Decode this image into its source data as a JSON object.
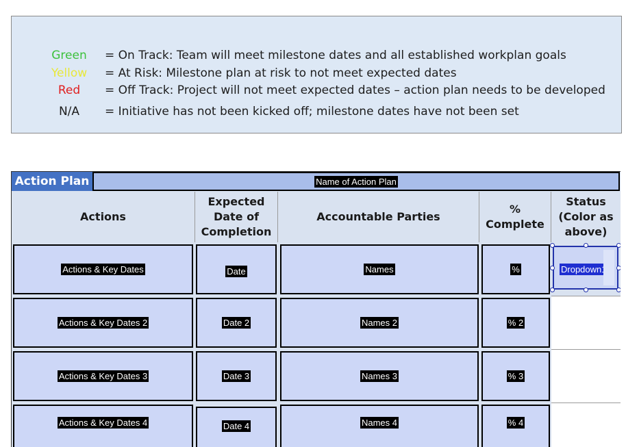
{
  "legend": {
    "items": [
      {
        "key": "Green",
        "color": "#3dc13c",
        "desc": "= On Track: Team will meet milestone dates and all established workplan goals"
      },
      {
        "key": "Yellow",
        "color": "#e8e83a",
        "desc": "= At Risk: Milestone plan at risk to not meet expected dates"
      },
      {
        "key": "Red",
        "color": "#e02020",
        "desc": "= Off Track: Project will not meet expected dates – action plan needs to be developed"
      },
      {
        "key": "N/A",
        "color": "#1d1d1d",
        "desc": "= Initiative has not been kicked off; milestone dates have not been set"
      }
    ]
  },
  "plan": {
    "title": "Action Plan",
    "name": "Name of Action Plan",
    "headers": {
      "actions": "Actions",
      "expected": "Expected Date of Completion",
      "parties": "Accountable Parties",
      "complete": "% Complete",
      "status": "Status (Color as above)"
    },
    "rows": [
      {
        "action": "Actions & Key Dates",
        "date": "Date",
        "names": "Names",
        "pct": "%"
      },
      {
        "action": "Actions & Key Dates 2",
        "date": "Date 2",
        "names": "Names 2",
        "pct": "% 2"
      },
      {
        "action": "Actions & Key Dates 3",
        "date": "Date 3",
        "names": "Names 3",
        "pct": "% 3"
      },
      {
        "action": "Actions & Key Dates 4",
        "date": "Date 4",
        "names": "Names 4",
        "pct": "% 4"
      }
    ],
    "status_dropdown": "Dropdown12"
  }
}
